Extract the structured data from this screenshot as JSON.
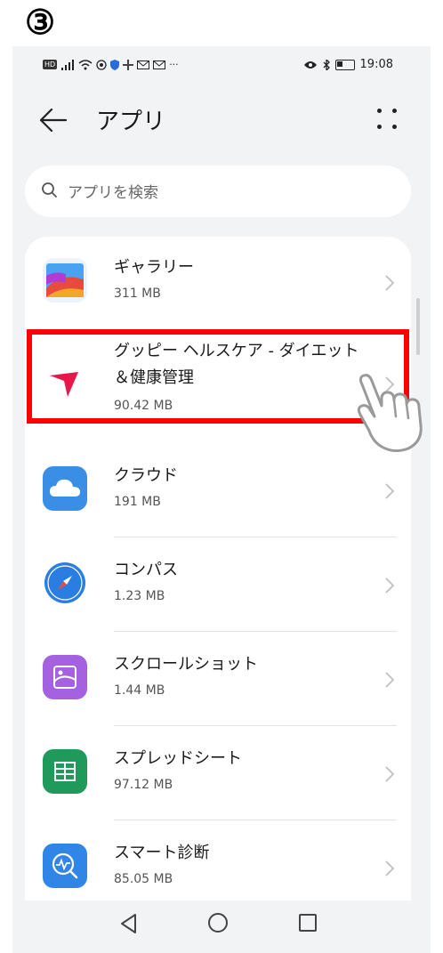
{
  "step_label": "③",
  "status": {
    "time": "19:08"
  },
  "header": {
    "title": "アプリ"
  },
  "search": {
    "placeholder": "アプリを検索"
  },
  "apps": [
    {
      "name": "ギャラリー",
      "size": "311 MB",
      "icon": "gallery-icon"
    },
    {
      "name": "グッピー ヘルスケア - ダイエット＆健康管理",
      "size": "90.42 MB",
      "icon": "guppy-icon"
    },
    {
      "name": "クラウド",
      "size": "191 MB",
      "icon": "cloud-icon"
    },
    {
      "name": "コンパス",
      "size": "1.23 MB",
      "icon": "compass-icon"
    },
    {
      "name": "スクロールショット",
      "size": "1.44 MB",
      "icon": "scrollshot-icon"
    },
    {
      "name": "スプレッドシート",
      "size": "97.12 MB",
      "icon": "spreadsheet-icon"
    },
    {
      "name": "スマート診断",
      "size": "85.05 MB",
      "icon": "smart-diagnosis-icon"
    }
  ],
  "colors": {
    "highlight": "#ff0000",
    "accent_red": "#e8174a",
    "background": "#f1f3f5"
  }
}
